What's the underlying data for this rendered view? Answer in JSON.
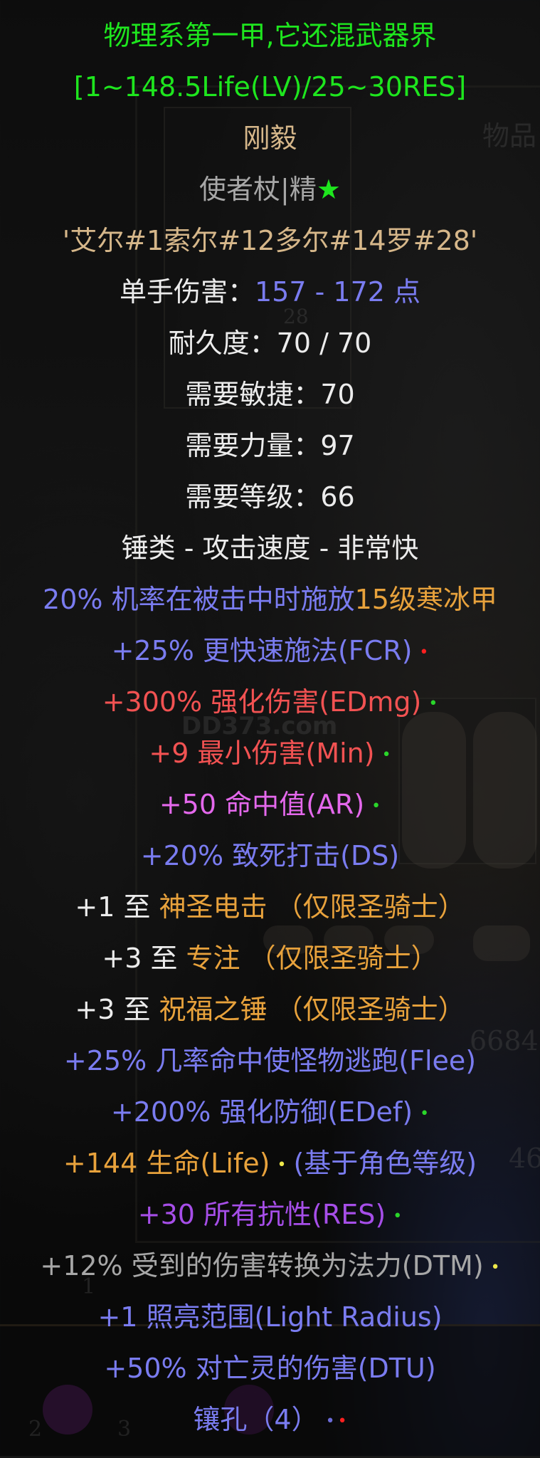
{
  "item": {
    "header1": "物理系第一甲,它还混武器界",
    "header2": "[1~148.5Life(LV)/25~30RES]",
    "name": "刚毅",
    "base": "使者杖|精",
    "base_star": "★",
    "runeword": "'艾尔#1索尔#12多尔#14罗#28'",
    "one_hand_damage_label": "单手伤害：",
    "one_hand_damage_value": "157 - 172 点",
    "durability": "耐久度：70 / 70",
    "req_dex": "需要敏捷：70",
    "req_str": "需要力量：97",
    "req_level": "需要等级：66",
    "speed": "锤类 - 攻击速度 - 非常快",
    "proc_a": "20% 机率在被击中时施放",
    "proc_b": "15级寒冰甲",
    "fcr": "+25% 更快速施法(FCR)",
    "edmg": "+300% 强化伤害(EDmg)",
    "min": "+9 最小伤害(Min)",
    "ar": "+50 命中值(AR)",
    "ds": "+20% 致死打击(DS)",
    "skill1_a": "+1 至 ",
    "skill1_b": "神圣电击 （仅限圣骑士）",
    "skill2_a": "+3 至 ",
    "skill2_b": "专注 （仅限圣骑士）",
    "skill3_a": "+3 至 ",
    "skill3_b": "祝福之锤 （仅限圣骑士）",
    "flee": "+25% 几率命中使怪物逃跑(Flee)",
    "edef": "+200% 强化防御(EDef)",
    "life_a": "+144 生命(Life)",
    "life_b": "(基于角色等级)",
    "res": "+30 所有抗性(RES)",
    "dtm": "+12% 受到的伤害转换为法力(DTM)",
    "light": "+1 照亮范围(Light Radius)",
    "dtu": "+50% 对亡灵的伤害(DTU)",
    "sockets": "镶孔（4）"
  },
  "dots": {
    "red": "•",
    "green": "•",
    "yellow": "•",
    "blue": "•"
  },
  "background": {
    "watermark": "DD373.com",
    "gold": "6684",
    "num_46": "46",
    "slot_1": "1",
    "slot_2": "2",
    "slot_3": "3",
    "stat_28": "28"
  },
  "colors": {
    "green": "#1ee61e",
    "gold": "#d6b78a",
    "blue": "#7a7cf0",
    "orange": "#e8a23c",
    "red": "#f25252",
    "magenta": "#e468ec",
    "purple": "#a64ee8",
    "grey": "#a7a7a7"
  }
}
